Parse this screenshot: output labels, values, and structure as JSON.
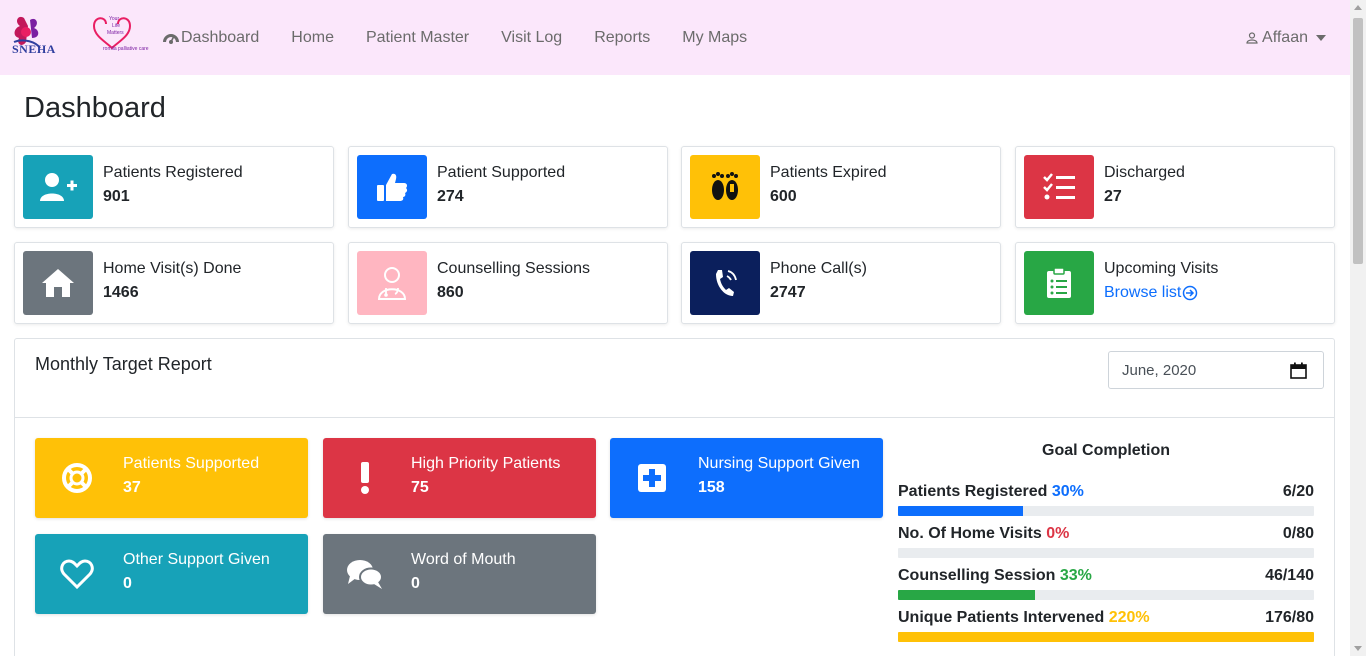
{
  "nav": {
    "brand": "SNEHA",
    "brand2_line1": "Your",
    "brand2_line2": "Life",
    "brand2_line3": "Matters",
    "brand2_sub": "romila palliative care",
    "links": [
      "Dashboard",
      "Home",
      "Patient Master",
      "Visit Log",
      "Reports",
      "My Maps"
    ],
    "user": "Affaan"
  },
  "page_title": "Dashboard",
  "stats": [
    {
      "label": "Patients Registered",
      "value": "901",
      "color": "#17a2b8",
      "icon": "user-plus-icon"
    },
    {
      "label": "Patient Supported",
      "value": "274",
      "color": "#0d6efd",
      "icon": "thumbs-up-icon"
    },
    {
      "label": "Patients Expired",
      "value": "600",
      "color": "#ffc107",
      "icon": "footprints-icon"
    },
    {
      "label": "Discharged",
      "value": "27",
      "color": "#dc3545",
      "icon": "checklist-icon"
    },
    {
      "label": "Home Visit(s) Done",
      "value": "1466",
      "color": "#6c757d",
      "icon": "home-icon"
    },
    {
      "label": "Counselling Sessions",
      "value": "860",
      "color": "#ffb6c1",
      "icon": "doctor-icon"
    },
    {
      "label": "Phone Call(s)",
      "value": "2747",
      "color": "#0b1f5c",
      "icon": "phone-icon"
    },
    {
      "label": "Upcoming Visits",
      "link": "Browse list",
      "color": "#28a745",
      "icon": "clipboard-icon"
    }
  ],
  "target": {
    "title": "Monthly Target Report",
    "month": "June, 2020",
    "boxes": [
      {
        "label": "Patients Supported",
        "value": "37",
        "color": "#ffc107",
        "icon": "lifebuoy-icon"
      },
      {
        "label": "High Priority Patients",
        "value": "75",
        "color": "#dc3545",
        "icon": "exclamation-icon"
      },
      {
        "label": "Nursing Support Given",
        "value": "158",
        "color": "#0d6efd",
        "icon": "plus-square-icon"
      },
      {
        "label": "Other Support Given",
        "value": "0",
        "color": "#17a2b8",
        "icon": "heart-icon"
      },
      {
        "label": "Word of Mouth",
        "value": "0",
        "color": "#6c757d",
        "icon": "comments-icon"
      }
    ],
    "goal_title": "Goal Completion",
    "goals": [
      {
        "label": "Patients Registered",
        "pct": "30%",
        "count": "6/20",
        "fraction": 0.3,
        "color": "#0d6efd"
      },
      {
        "label": "No. Of Home Visits",
        "pct": "0%",
        "count": "0/80",
        "fraction": 0.0,
        "color": "#dc3545"
      },
      {
        "label": "Counselling Session",
        "pct": "33%",
        "count": "46/140",
        "fraction": 0.33,
        "color": "#28a745"
      },
      {
        "label": "Unique Patients Intervened",
        "pct": "220%",
        "count": "176/80",
        "fraction": 1.0,
        "color": "#ffc107"
      }
    ]
  }
}
